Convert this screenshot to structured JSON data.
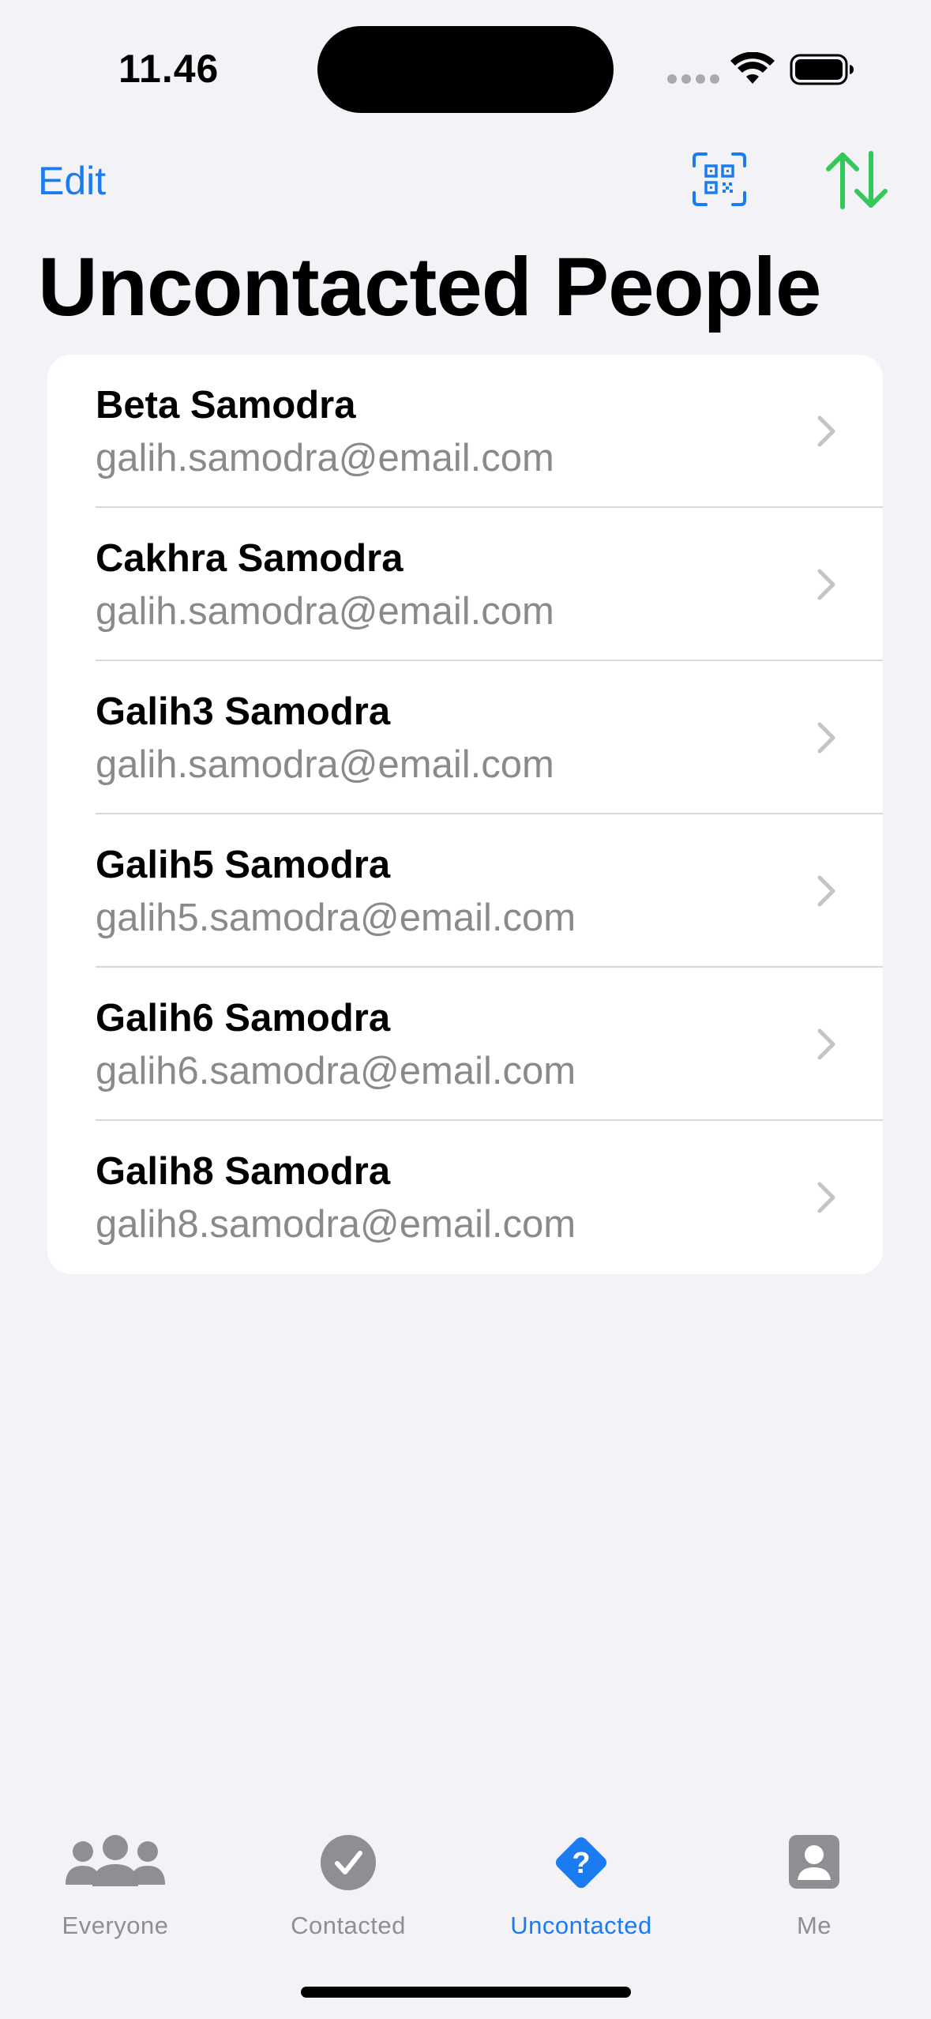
{
  "status_bar": {
    "time": "11.46"
  },
  "nav": {
    "edit_label": "Edit",
    "title": "Uncontacted People",
    "qr_icon": "qr-code-scan-icon",
    "sort_icon": "arrow-up-down-icon",
    "accent_color": "#1a7cf0",
    "sort_color": "#34c759"
  },
  "contacts": [
    {
      "name": "Beta Samodra",
      "email": "galih.samodra@email.com"
    },
    {
      "name": "Cakhra Samodra",
      "email": "galih.samodra@email.com"
    },
    {
      "name": "Galih3 Samodra",
      "email": "galih.samodra@email.com"
    },
    {
      "name": "Galih5 Samodra",
      "email": "galih5.samodra@email.com"
    },
    {
      "name": "Galih6 Samodra",
      "email": "galih6.samodra@email.com"
    },
    {
      "name": "Galih8 Samodra",
      "email": "galih8.samodra@email.com"
    }
  ],
  "tabs": [
    {
      "label": "Everyone",
      "icon": "people-icon",
      "active": false
    },
    {
      "label": "Contacted",
      "icon": "checkmark-circle-icon",
      "active": false
    },
    {
      "label": "Uncontacted",
      "icon": "questionmark-diamond-icon",
      "active": true
    },
    {
      "label": "Me",
      "icon": "person-square-icon",
      "active": false
    }
  ]
}
